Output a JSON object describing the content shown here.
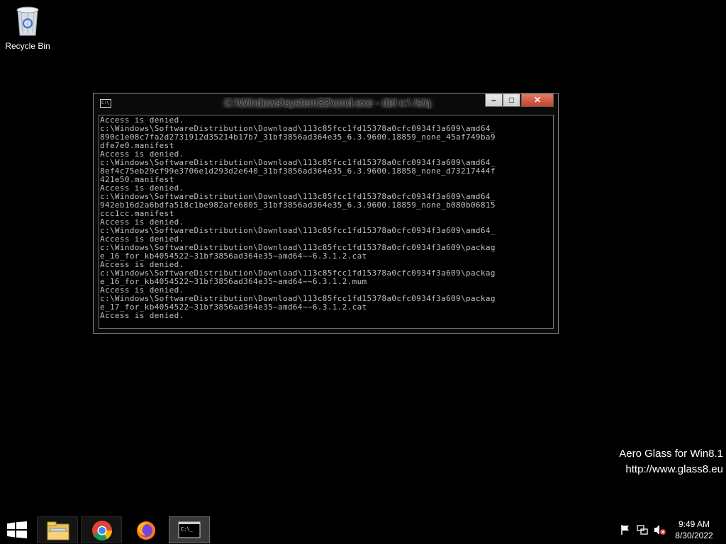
{
  "desktop": {
    "recycle_bin_label": "Recycle Bin",
    "watermark_line1": "Aero Glass for Win8.1",
    "watermark_line2": "http://www.glass8.eu"
  },
  "window": {
    "title": "C:\\Windows\\system32\\cmd.exe - del  c:\\ /s/q",
    "app_icon_text": "C:\\",
    "minimize": "–",
    "maximize": "□",
    "close": "✕",
    "console_lines": [
      "Access is denied.",
      "c:\\Windows\\SoftwareDistribution\\Download\\113c85fcc1fd15378a0cfc0934f3a609\\amd64_",
      "890c1e08c7fa2d2731912d35214b17b7_31bf3856ad364e35_6.3.9600.18859_none_45af749ba9",
      "dfe7e0.manifest",
      "Access is denied.",
      "c:\\Windows\\SoftwareDistribution\\Download\\113c85fcc1fd15378a0cfc0934f3a609\\amd64_",
      "8ef4c75eb29cf99e3706e1d293d2e640_31bf3856ad364e35_6.3.9600.18858_none_d73217444f",
      "421e50.manifest",
      "Access is denied.",
      "c:\\Windows\\SoftwareDistribution\\Download\\113c85fcc1fd15378a0cfc0934f3a609\\amd64_",
      "942eb16d2a6bdfa518c1be982afe6805_31bf3856ad364e35_6.3.9600.18859_none_b080b06815",
      "ccc1cc.manifest",
      "Access is denied.",
      "c:\\Windows\\SoftwareDistribution\\Download\\113c85fcc1fd15378a0cfc0934f3a609\\amd64_",
      "Access is denied.",
      "c:\\Windows\\SoftwareDistribution\\Download\\113c85fcc1fd15378a0cfc0934f3a609\\packag",
      "e_16_for_kb4054522~31bf3856ad364e35~amd64~~6.3.1.2.cat",
      "Access is denied.",
      "c:\\Windows\\SoftwareDistribution\\Download\\113c85fcc1fd15378a0cfc0934f3a609\\packag",
      "e_16_for_kb4054522~31bf3856ad364e35~amd64~~6.3.1.2.mum",
      "Access is denied.",
      "c:\\Windows\\SoftwareDistribution\\Download\\113c85fcc1fd15378a0cfc0934f3a609\\packag",
      "e_17_for_kb4054522~31bf3856ad364e35~amd64~~6.3.1.2.cat",
      "Access is denied."
    ]
  },
  "taskbar": {
    "items": [
      {
        "icon": "file-explorer-icon"
      },
      {
        "icon": "chrome-icon"
      },
      {
        "icon": "firefox-icon"
      },
      {
        "icon": "cmd-icon",
        "active": true
      }
    ],
    "time": "9:49 AM",
    "date": "8/30/2022"
  }
}
